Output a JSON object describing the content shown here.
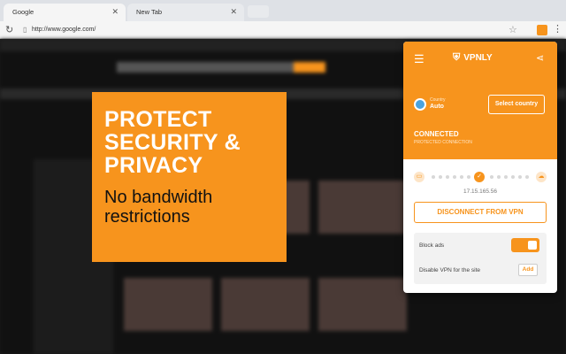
{
  "browser": {
    "tabs": [
      {
        "label": "Google",
        "close": "✕"
      },
      {
        "label": "New Tab",
        "close": "✕"
      }
    ],
    "url": "http://www.google.com/"
  },
  "promo": {
    "headline": [
      "PROTECT",
      "SECURITY &",
      "PRIVACY"
    ],
    "subtext": [
      "No bandwidth",
      "restrictions"
    ]
  },
  "vpn": {
    "brand": "VPNLY",
    "country_label": "Country",
    "country_value": "Auto",
    "select_country": "Select country",
    "status": "CONNECTED",
    "status_sub": "PROTECTED CONNECTION",
    "ip": "17.15.165.56",
    "disconnect": "DISCONNECT FROM VPN",
    "block_ads": "Block ads",
    "block_ads_on": true,
    "disable_site": "Disable VPN for the site",
    "add": "Add"
  },
  "colors": {
    "accent": "#f7941d"
  }
}
